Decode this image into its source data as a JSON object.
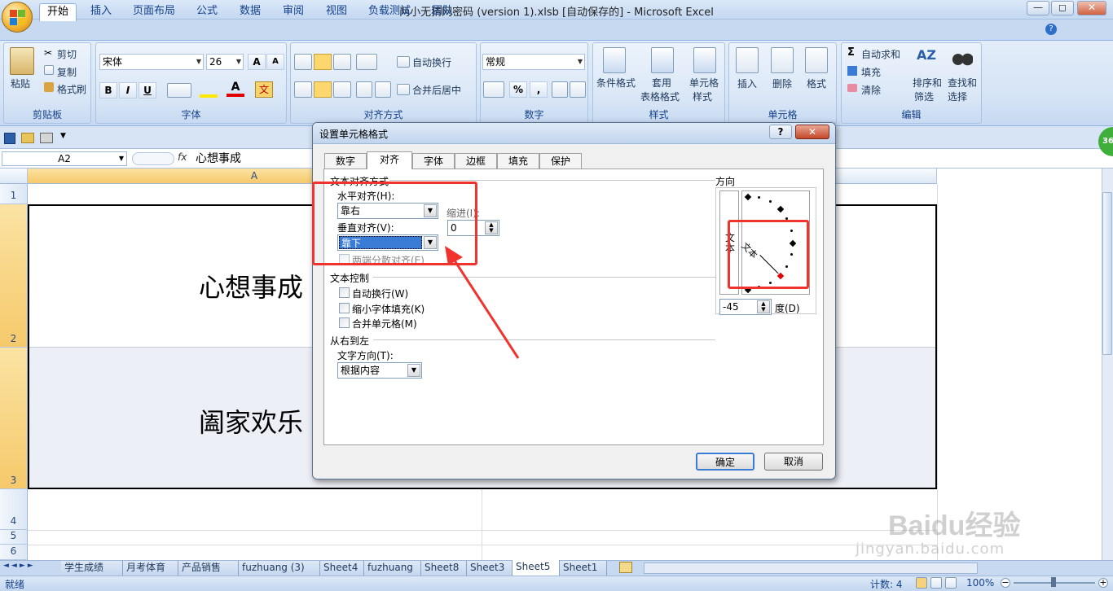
{
  "window": {
    "title": "两小无猜网密码 (version 1).xlsb [自动保存的] - Microsoft Excel",
    "min": "—",
    "max": "◻",
    "close": "✕"
  },
  "ribbon_tabs": [
    "开始",
    "插入",
    "页面布局",
    "公式",
    "数据",
    "审阅",
    "视图",
    "负载测试",
    "团队"
  ],
  "ribbon": {
    "clipboard": {
      "label": "剪贴板",
      "paste": "粘贴",
      "cut": "剪切",
      "copy": "复制",
      "format_painter": "格式刷"
    },
    "font": {
      "label": "字体",
      "font_name": "宋体",
      "font_size": "26",
      "bold": "B",
      "italic": "I",
      "underline": "U",
      "grow": "A",
      "shrink": "A",
      "color_a": "A",
      "phonetic": "文"
    },
    "alignment": {
      "label": "对齐方式",
      "wrap": "自动换行",
      "merge": "合并后居中"
    },
    "number": {
      "label": "数字",
      "format": "常规",
      "percent": "%",
      "comma": ","
    },
    "styles": {
      "label": "样式",
      "conditional": "条件格式",
      "table_fmt_1": "套用",
      "table_fmt_2": "表格格式",
      "cell_style_1": "单元格",
      "cell_style_2": "样式"
    },
    "cells": {
      "label": "单元格",
      "insert": "插入",
      "delete": "删除",
      "format": "格式"
    },
    "editing": {
      "label": "编辑",
      "autosum": "自动求和",
      "fill": "填充",
      "clear": "清除",
      "sort_1": "排序和",
      "sort_2": "筛选",
      "find_1": "查找和",
      "find_2": "选择"
    }
  },
  "formula_bar": {
    "name_box": "A2",
    "fx": "fx",
    "content": "心想事成"
  },
  "grid": {
    "col_a": "A",
    "rows": [
      "1",
      "2",
      "3",
      "4",
      "5",
      "6"
    ],
    "cell_a2": "心想事成",
    "cell_a3": "阖家欢乐"
  },
  "sheets": [
    "学生成绩",
    "月考体育",
    "产品销售",
    "fuzhuang (3)",
    "Sheet4",
    "fuzhuang",
    "Sheet8",
    "Sheet3",
    "Sheet5",
    "Sheet1"
  ],
  "active_sheet": "Sheet5",
  "status": {
    "ready": "就绪",
    "count": "计数: 4",
    "zoom": "100%"
  },
  "badge": "36",
  "dialog": {
    "title": "设置单元格格式",
    "help": "?",
    "close": "✕",
    "tabs": [
      "数字",
      "对齐",
      "字体",
      "边框",
      "填充",
      "保护"
    ],
    "active_tab": "对齐",
    "text_align_section": "文本对齐方式",
    "horizontal_label": "水平对齐(H):",
    "horizontal_value": "靠右",
    "indent_label": "缩进(I):",
    "indent_value": "0",
    "vertical_label": "垂直对齐(V):",
    "vertical_value": "靠下",
    "justify_distributed": "两端分散对齐(E)",
    "text_control_section": "文本控制",
    "wrap_text": "自动换行(W)",
    "shrink_to_fit": "缩小字体填充(K)",
    "merge_cells": "合并单元格(M)",
    "rtl_section": "从右到左",
    "text_direction_label": "文字方向(T):",
    "text_direction_value": "根据内容",
    "orientation_section": "方向",
    "vertical_text": "文本",
    "rotated_text": "文本",
    "degrees_value": "-45",
    "degrees_label": "度(D)",
    "ok": "确定",
    "cancel": "取消"
  },
  "watermark": {
    "brand": "Baidu经验",
    "url": "jingyan.baidu.com"
  },
  "colors": {
    "accent_red": "#f0342d",
    "ribbon_blue": "#c7d9f1",
    "selection": "#3a7bd5"
  }
}
